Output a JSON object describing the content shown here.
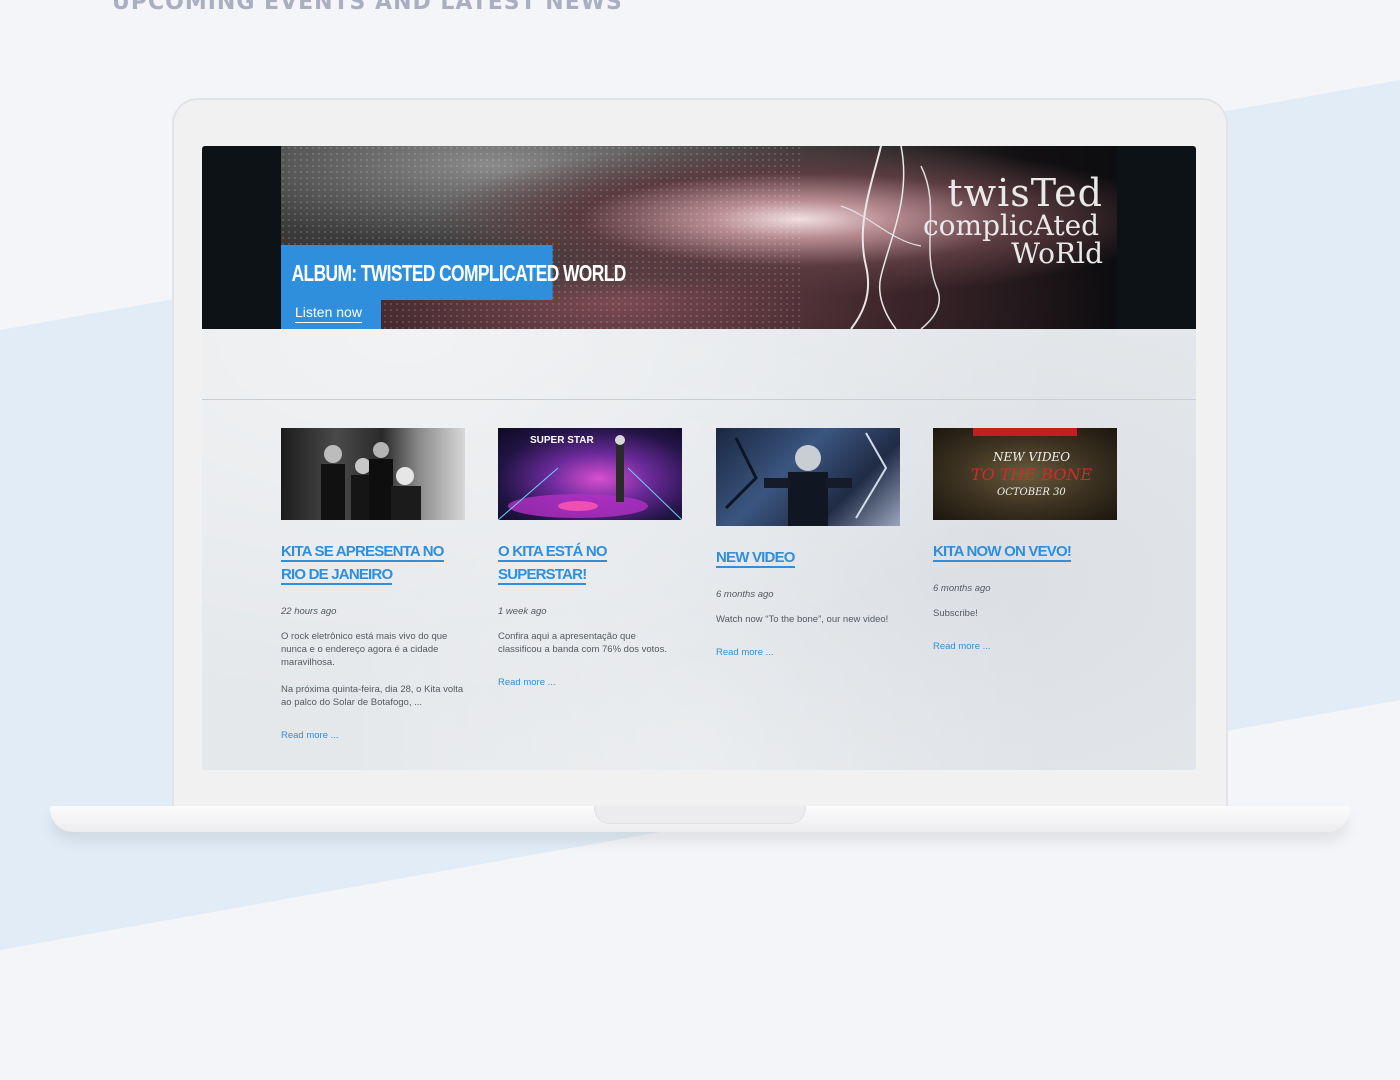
{
  "page": {
    "heading": "UPCOMING EVENTS AND LATEST NEWS"
  },
  "colors": {
    "accent": "#2f8fdc",
    "page_bg": "#f4f5f9",
    "band": "#e1ecf6",
    "heading": "#a9aec1"
  },
  "hero": {
    "title": "ALBUM: TWISTED COMPLICATED WORLD",
    "button_label": "Listen now",
    "logo_line1": "twisTed",
    "logo_line2": "complicAted",
    "logo_line3": "WoRld"
  },
  "posts": [
    {
      "title": "KITA SE APRESENTA NO RIO DE JANEIRO",
      "date": "22 hours ago",
      "excerpt": [
        "O rock eletrônico está mais vivo do que nunca e o endereço agora é a cidade maravilhosa.",
        "Na próxima quinta-feira, dia 28, o Kita volta ao palco do Solar de Botafogo, ..."
      ],
      "read_more": "Read more ..."
    },
    {
      "title": "O KITA ESTÁ NO SUPERSTAR!",
      "date": "1 week ago",
      "excerpt": [
        "Confira aqui a apresentação que classificou a banda com 76% dos votos."
      ],
      "read_more": "Read more ...",
      "thumb_text": "SUPER STAR"
    },
    {
      "title": "NEW VIDEO",
      "date": "6 months ago",
      "excerpt": [
        "Watch now “To the bone”, our new video!"
      ],
      "read_more": "Read more ..."
    },
    {
      "title": "KITA NOW ON VEVO!",
      "date": "6 months ago",
      "excerpt": [
        "Subscribe!"
      ],
      "read_more": "Read more ...",
      "thumb_line1": "NEW VIDEO",
      "thumb_line2": "TO THE BONE",
      "thumb_line3": "OCTOBER 30"
    }
  ]
}
